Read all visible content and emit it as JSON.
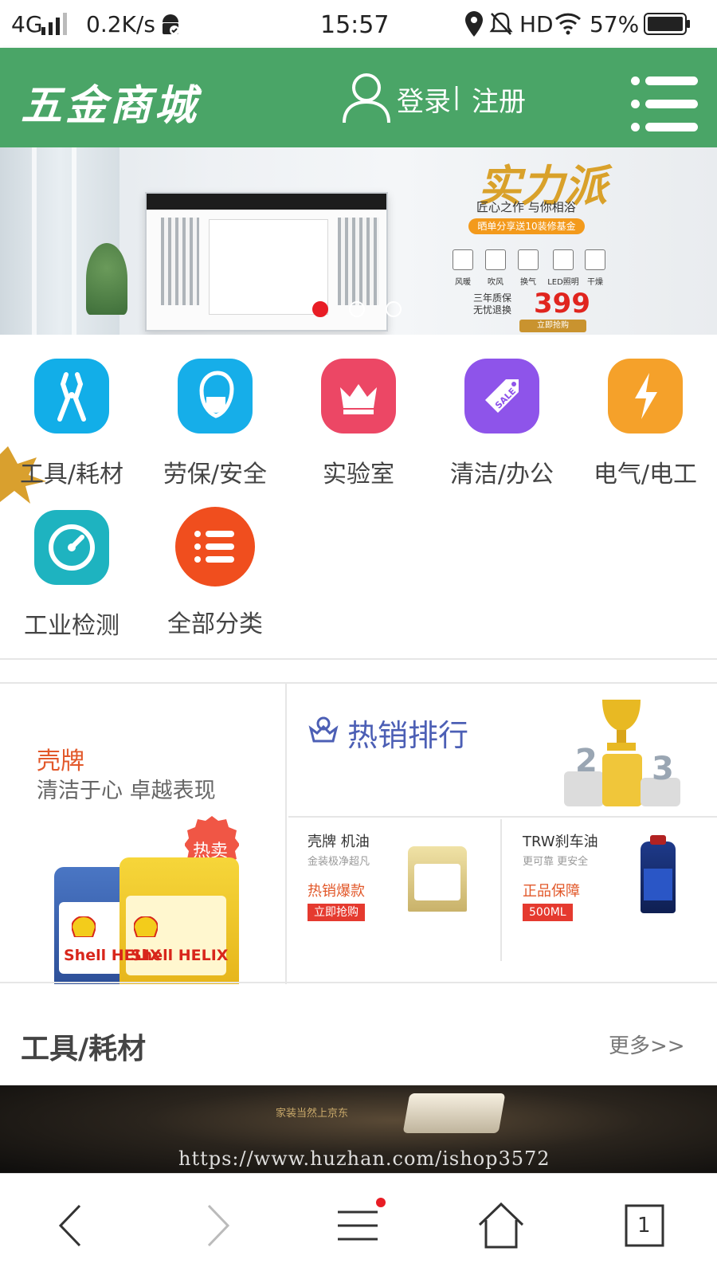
{
  "status_bar": {
    "network": "4G",
    "speed": "0.2K/s",
    "time": "15:57",
    "hd": "HD",
    "battery": "57%"
  },
  "header": {
    "logo": "五金商城",
    "login": "登录",
    "separator": "|",
    "register": "注册"
  },
  "banner": {
    "headline": "实力派",
    "subline": "匠心之作 与你相浴",
    "promo": "晒单分享送10装修基金",
    "features": [
      "风暖",
      "吹风",
      "换气",
      "LED照明",
      "干燥"
    ],
    "guarantee": "三年质保 无忧退换",
    "price": "399",
    "buy": "立即抢购",
    "slides": 3,
    "active_slide": 1
  },
  "categories": [
    {
      "label": "工具/耗材",
      "icon": "pliers-icon",
      "color": "#12aee8"
    },
    {
      "label": "劳保/安全",
      "icon": "mask-icon",
      "color": "#16aee9"
    },
    {
      "label": "实验室",
      "icon": "crown-icon",
      "color": "#ec4765"
    },
    {
      "label": "清洁/办公",
      "icon": "sale-tag-icon",
      "color": "#8e54ea"
    },
    {
      "label": "电气/电工",
      "icon": "lightning-icon",
      "color": "#f5a12a"
    },
    {
      "label": "工业检测",
      "icon": "gauge-icon",
      "color": "#1eb3c0"
    },
    {
      "label": "全部分类",
      "icon": "list-icon",
      "color": "#f04e1e"
    }
  ],
  "promo": {
    "brand": "壳牌",
    "slogan": "清洁于心 卓越表现",
    "badge": "热卖",
    "can_labels": [
      "Shell HELIX",
      "Shell HELIX"
    ],
    "ranking_title": "热销排行",
    "products": [
      {
        "name": "壳牌 机油",
        "desc": "金装极净超凡",
        "tag": "热销爆款",
        "button": "立即抢购"
      },
      {
        "name": "TRW刹车油",
        "desc": "更可靠 更安全",
        "tag": "正品保障",
        "button": "500ML"
      }
    ]
  },
  "section": {
    "title": "工具/耗材",
    "more": "更多>>"
  },
  "bottom_banner": {
    "small_text": "家装当然上京东",
    "watermark": "https://www.huzhan.com/ishop3572"
  },
  "bottom_nav": {
    "tabs_count": "1"
  }
}
